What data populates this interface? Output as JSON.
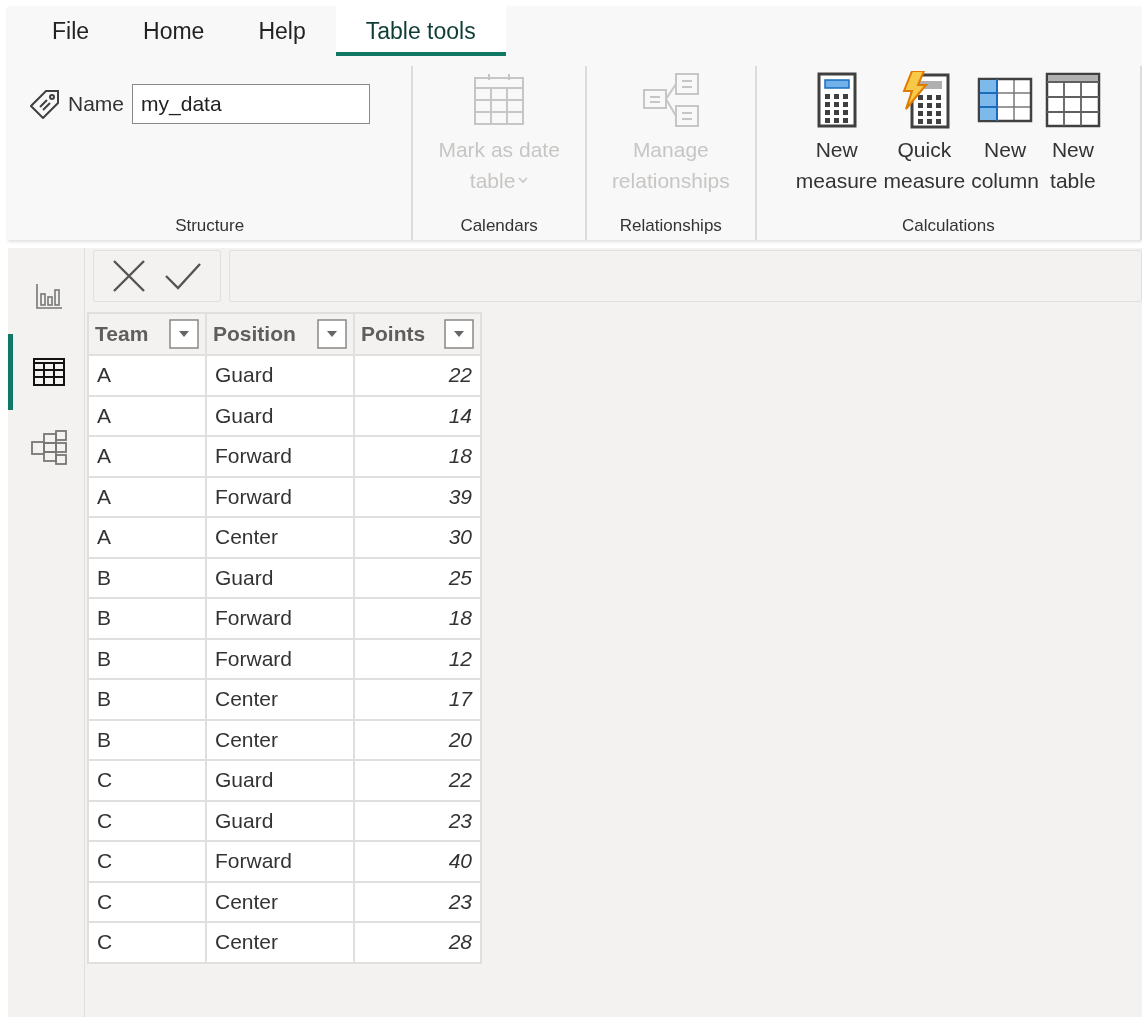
{
  "tabs": [
    {
      "label": "File",
      "selected": false
    },
    {
      "label": "Home",
      "selected": false
    },
    {
      "label": "Help",
      "selected": false
    },
    {
      "label": "Table tools",
      "selected": true
    }
  ],
  "ribbon": {
    "groups": [
      {
        "label": "Structure",
        "kind": "name",
        "field": {
          "label": "Name",
          "value": "my_data"
        }
      },
      {
        "label": "Calendars",
        "kind": "buttons",
        "buttons": [
          {
            "lines": [
              "Mark as date",
              "table"
            ],
            "kind": "calendar",
            "disabled": true,
            "dropdown": true
          }
        ]
      },
      {
        "label": "Relationships",
        "kind": "buttons",
        "buttons": [
          {
            "lines": [
              "Manage",
              "relationships"
            ],
            "kind": "relationships",
            "disabled": true,
            "dropdown": false
          }
        ]
      },
      {
        "label": "Calculations",
        "kind": "buttons",
        "buttons": [
          {
            "lines": [
              "New",
              "measure"
            ],
            "kind": "calculator",
            "disabled": false,
            "dropdown": false
          },
          {
            "lines": [
              "Quick",
              "measure"
            ],
            "kind": "quick-calculator",
            "disabled": false,
            "dropdown": false
          },
          {
            "lines": [
              "New",
              "column"
            ],
            "kind": "column",
            "disabled": false,
            "dropdown": false
          },
          {
            "lines": [
              "New",
              "table"
            ],
            "kind": "table",
            "disabled": false,
            "dropdown": false
          }
        ]
      }
    ]
  },
  "views": [
    {
      "kind": "report",
      "selected": false
    },
    {
      "kind": "table",
      "selected": true
    },
    {
      "kind": "model",
      "selected": false
    }
  ],
  "table": {
    "columns": [
      {
        "label": "Team",
        "kind": "text"
      },
      {
        "label": "Position",
        "kind": "text"
      },
      {
        "label": "Points",
        "kind": "number"
      }
    ],
    "rows": [
      [
        "A",
        "Guard",
        "22"
      ],
      [
        "A",
        "Guard",
        "14"
      ],
      [
        "A",
        "Forward",
        "18"
      ],
      [
        "A",
        "Forward",
        "39"
      ],
      [
        "A",
        "Center",
        "30"
      ],
      [
        "B",
        "Guard",
        "25"
      ],
      [
        "B",
        "Forward",
        "18"
      ],
      [
        "B",
        "Forward",
        "12"
      ],
      [
        "B",
        "Center",
        "17"
      ],
      [
        "B",
        "Center",
        "20"
      ],
      [
        "C",
        "Guard",
        "22"
      ],
      [
        "C",
        "Guard",
        "23"
      ],
      [
        "C",
        "Forward",
        "40"
      ],
      [
        "C",
        "Center",
        "23"
      ],
      [
        "C",
        "Center",
        "28"
      ]
    ]
  }
}
